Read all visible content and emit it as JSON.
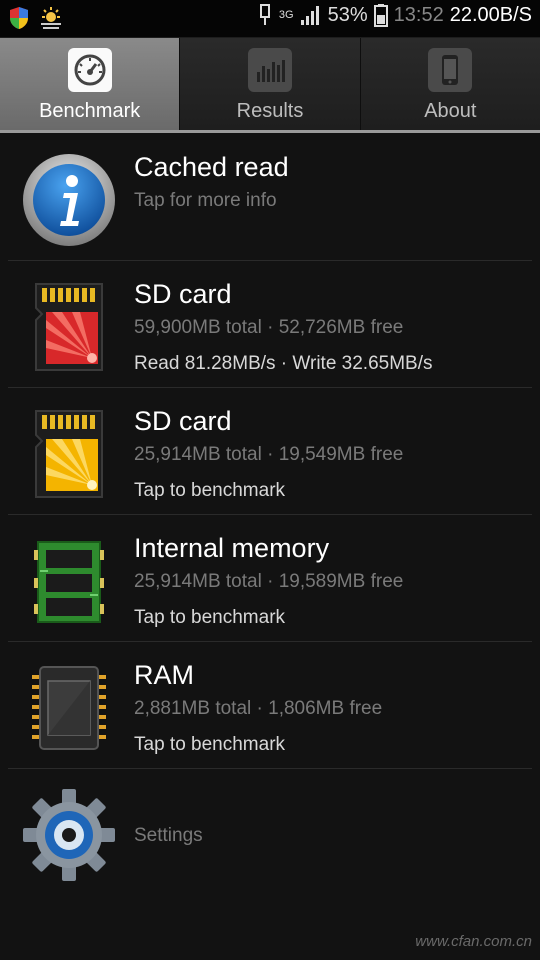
{
  "status_bar": {
    "signal_type": "3G",
    "battery_percent": "53%",
    "time": "13:52",
    "net_speed": "22.00B/S"
  },
  "tabs": [
    {
      "label": "Benchmark",
      "icon": "speedometer-icon",
      "active": true
    },
    {
      "label": "Results",
      "icon": "bar-chart-icon",
      "active": false
    },
    {
      "label": "About",
      "icon": "phone-icon",
      "active": false
    }
  ],
  "items": [
    {
      "title": "Cached read",
      "subtitle": "Tap for more info",
      "icon": "info-icon"
    },
    {
      "title": "SD card",
      "subtitle": "59,900MB total · 52,726MB free",
      "detail": "Read 81.28MB/s · Write 32.65MB/s",
      "icon": "sd-card-red-icon"
    },
    {
      "title": "SD card",
      "subtitle": "25,914MB total · 19,549MB free",
      "detail": "Tap to benchmark",
      "icon": "sd-card-yellow-icon"
    },
    {
      "title": "Internal memory",
      "subtitle": "25,914MB total · 19,589MB free",
      "detail": "Tap to benchmark",
      "icon": "memory-chip-icon"
    },
    {
      "title": "RAM",
      "subtitle": "2,881MB total · 1,806MB free",
      "detail": "Tap to benchmark",
      "icon": "ram-chip-icon"
    },
    {
      "title": "Settings",
      "icon": "gear-icon"
    }
  ],
  "colors": {
    "background": "#121212",
    "active_tab": "#7a7a7a",
    "subtitle": "#7a7a7a",
    "info_blue": "#1e6fc7"
  },
  "watermark": "www.cfan.com.cn"
}
